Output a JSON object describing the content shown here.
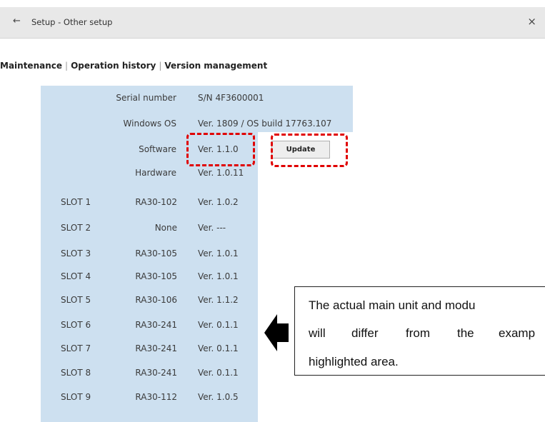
{
  "window": {
    "title": "Setup - Other setup",
    "back_icon": "←",
    "close_icon": "×"
  },
  "tabs": [
    "Maintenance",
    "Operation history",
    "Version management"
  ],
  "tab_separator": "|",
  "info": {
    "serial_label": "Serial number",
    "serial_value": "S/N 4F3600001",
    "os_label": "Windows OS",
    "os_value": "Ver. 1809 / OS build 17763.107",
    "software_label": "Software",
    "software_value": "Ver. 1.1.0",
    "hardware_label": "Hardware",
    "hardware_value": "Ver. 1.0.11",
    "update_button": "Update"
  },
  "slots": [
    {
      "slot": "SLOT 1",
      "model": "RA30-102",
      "version": "Ver. 1.0.2"
    },
    {
      "slot": "SLOT 2",
      "model": "None",
      "version": "Ver. ---"
    },
    {
      "slot": "SLOT 3",
      "model": "RA30-105",
      "version": "Ver. 1.0.1"
    },
    {
      "slot": "SLOT 4",
      "model": "RA30-105",
      "version": "Ver. 1.0.1"
    },
    {
      "slot": "SLOT 5",
      "model": "RA30-106",
      "version": "Ver. 1.1.2"
    },
    {
      "slot": "SLOT 6",
      "model": "RA30-241",
      "version": "Ver. 0.1.1"
    },
    {
      "slot": "SLOT 7",
      "model": "RA30-241",
      "version": "Ver. 0.1.1"
    },
    {
      "slot": "SLOT 8",
      "model": "RA30-241",
      "version": "Ver. 0.1.1"
    },
    {
      "slot": "SLOT 9",
      "model": "RA30-112",
      "version": "Ver. 1.0.5"
    }
  ],
  "note": {
    "line1": "The actual main unit and modu",
    "line2_a": "will",
    "line2_b": "differ",
    "line2_c": "from",
    "line2_d": "the",
    "line2_e": "examp",
    "line3": "highlighted area."
  },
  "colors": {
    "panel": "#cde0f0",
    "highlight": "#e00000"
  }
}
